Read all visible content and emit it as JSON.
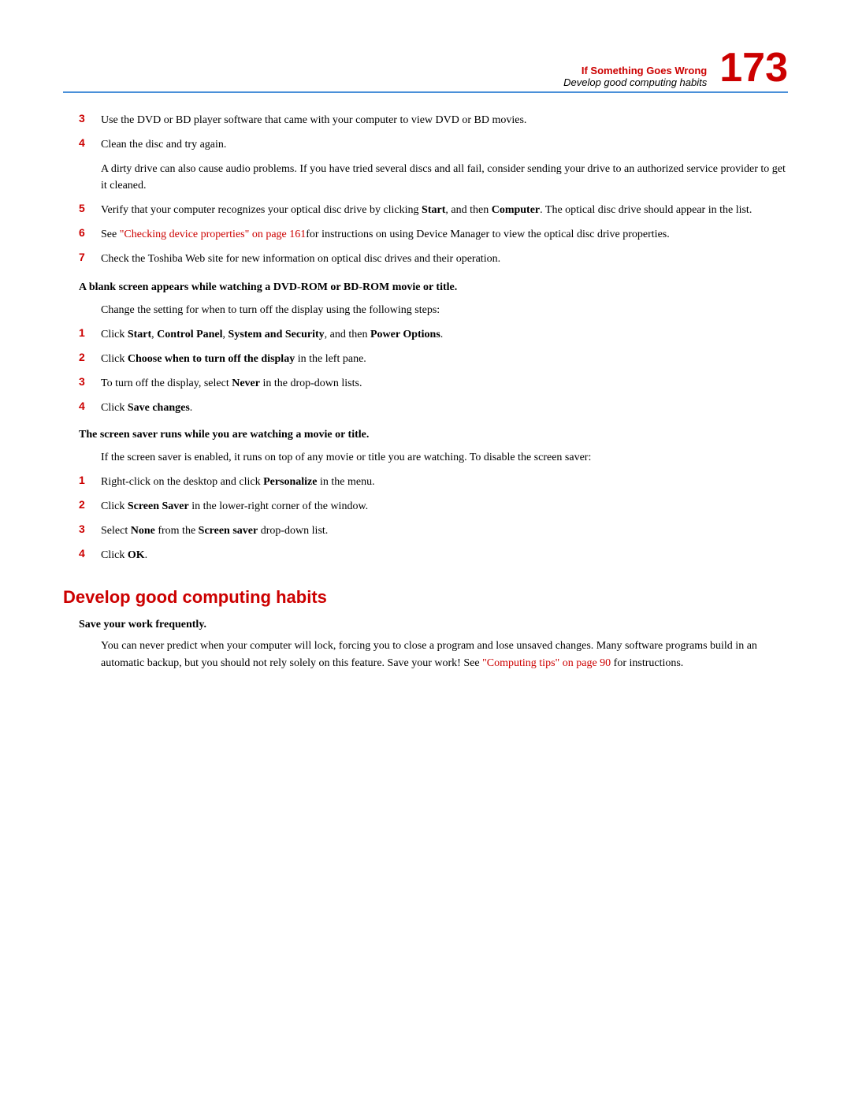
{
  "header": {
    "chapter": "If Something Goes Wrong",
    "section": "Develop good computing habits",
    "page_number": "173"
  },
  "items_top": [
    {
      "number": "3",
      "color": "red",
      "text": "Use the DVD or BD player software that came with your computer to view DVD or BD movies."
    },
    {
      "number": "4",
      "color": "red",
      "text": "Clean the disc and try again."
    }
  ],
  "sub_para_item4": "A dirty drive can also cause audio problems. If you have tried several discs and all fail, consider sending your drive to an authorized service provider to get it cleaned.",
  "items_5_to_7": [
    {
      "number": "5",
      "color": "red",
      "text_parts": [
        {
          "text": "Verify that your computer recognizes your optical disc drive by clicking ",
          "bold": false
        },
        {
          "text": "Start",
          "bold": true
        },
        {
          "text": ", and then ",
          "bold": false
        },
        {
          "text": "Computer",
          "bold": true
        },
        {
          "text": ". The optical disc drive should appear in the list.",
          "bold": false
        }
      ]
    },
    {
      "number": "6",
      "color": "red",
      "text_before_link": "See ",
      "link_text": "\"Checking device properties\" on page 161",
      "text_after_link": "for instructions on using Device Manager to view the optical disc drive properties."
    },
    {
      "number": "7",
      "color": "red",
      "text": "Check the Toshiba Web site for new information on optical disc drives and their operation."
    }
  ],
  "blank_screen_heading": "A blank screen appears while watching a DVD-ROM or BD-ROM movie or title.",
  "blank_screen_intro": "Change the setting for when to turn off the display using the following steps:",
  "blank_screen_steps": [
    {
      "number": "1",
      "color": "red",
      "text_parts": [
        {
          "text": "Click ",
          "bold": false
        },
        {
          "text": "Start",
          "bold": true
        },
        {
          "text": ", ",
          "bold": false
        },
        {
          "text": "Control Panel",
          "bold": true
        },
        {
          "text": ", ",
          "bold": false
        },
        {
          "text": "System and Security",
          "bold": true
        },
        {
          "text": ", and then ",
          "bold": false
        },
        {
          "text": "Power Options",
          "bold": true
        },
        {
          "text": ".",
          "bold": false
        }
      ]
    },
    {
      "number": "2",
      "color": "red",
      "text_parts": [
        {
          "text": "Click ",
          "bold": false
        },
        {
          "text": "Choose when to turn off the display",
          "bold": true
        },
        {
          "text": " in the left pane.",
          "bold": false
        }
      ]
    },
    {
      "number": "3",
      "color": "red",
      "text_parts": [
        {
          "text": "To turn off the display, select ",
          "bold": false
        },
        {
          "text": "Never",
          "bold": true
        },
        {
          "text": " in the drop-down lists.",
          "bold": false
        }
      ]
    },
    {
      "number": "4",
      "color": "red",
      "text_parts": [
        {
          "text": "Click ",
          "bold": false
        },
        {
          "text": "Save changes",
          "bold": true
        },
        {
          "text": ".",
          "bold": false
        }
      ]
    }
  ],
  "screen_saver_heading": "The screen saver runs while you are watching a movie or title.",
  "screen_saver_intro": "If the screen saver is enabled, it runs on top of any movie or title you are watching. To disable the screen saver:",
  "screen_saver_steps": [
    {
      "number": "1",
      "color": "red",
      "text_parts": [
        {
          "text": "Right-click on the desktop and click ",
          "bold": false
        },
        {
          "text": "Personalize",
          "bold": true
        },
        {
          "text": " in the menu.",
          "bold": false
        }
      ]
    },
    {
      "number": "2",
      "color": "red",
      "text_parts": [
        {
          "text": "Click ",
          "bold": false
        },
        {
          "text": "Screen Saver",
          "bold": true
        },
        {
          "text": " in the lower-right corner of the window.",
          "bold": false
        }
      ]
    },
    {
      "number": "3",
      "color": "red",
      "text_parts": [
        {
          "text": "Select ",
          "bold": false
        },
        {
          "text": "None",
          "bold": true
        },
        {
          "text": " from the ",
          "bold": false
        },
        {
          "text": "Screen saver",
          "bold": true
        },
        {
          "text": " drop-down list.",
          "bold": false
        }
      ]
    },
    {
      "number": "4",
      "color": "red",
      "text_parts": [
        {
          "text": "Click ",
          "bold": false
        },
        {
          "text": "OK",
          "bold": true
        },
        {
          "text": ".",
          "bold": false
        }
      ]
    }
  ],
  "develop_habits_title": "Develop good computing habits",
  "save_work_heading": "Save your work frequently.",
  "save_work_text_before_link": "You can never predict when your computer will lock, forcing you to close a program and lose unsaved changes. Many software programs build in an automatic backup, but you should not rely solely on this feature. Save your work! See ",
  "save_work_link": "\"Computing tips\" on page 90",
  "save_work_text_after_link": " for instructions."
}
